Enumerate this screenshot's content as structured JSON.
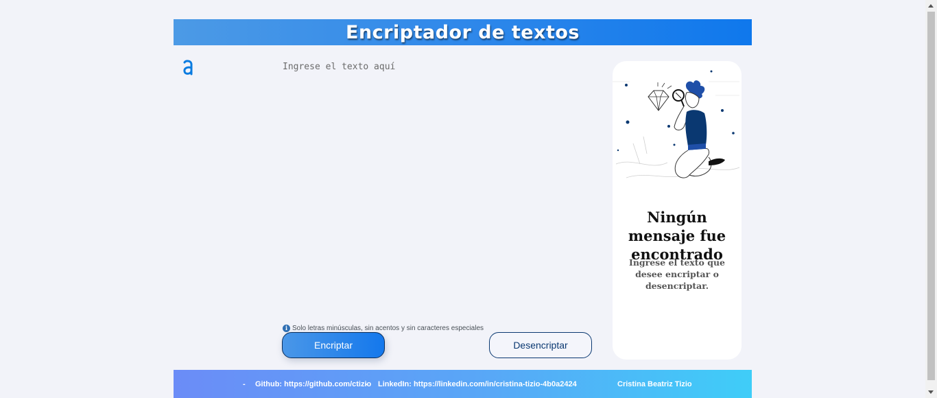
{
  "header": {
    "title": "Encriptador de textos"
  },
  "logo": {
    "icon": "alura-logo-icon",
    "color": "#0a7be0"
  },
  "input": {
    "placeholder": "Ingrese el texto aquí",
    "value": ""
  },
  "hint": {
    "icon": "info-icon",
    "text": "Solo letras minúsculas, sin acentos y sin caracteres especiales"
  },
  "buttons": {
    "encrypt": "Encriptar",
    "decrypt": "Desencriptar"
  },
  "result": {
    "illustration": "person-with-magnifier-illustration",
    "title": "Ningún mensaje fue encontrado",
    "description": "Ingrese el texto que desee encriptar o desencriptar."
  },
  "footer": {
    "dash1": "-",
    "github": "Github: https://github.com/ctizio",
    "dash2": "-",
    "linkedin": "LinkedIn: https://linkedin.com/in/cristina-tizio-4b0a2424",
    "author": "Cristina Beatriz Tizio"
  },
  "colors": {
    "accent": "#0a3871",
    "header_gradient_start": "#4c9ae6",
    "header_gradient_end": "#0f78ec",
    "background": "#f2f3f9"
  }
}
